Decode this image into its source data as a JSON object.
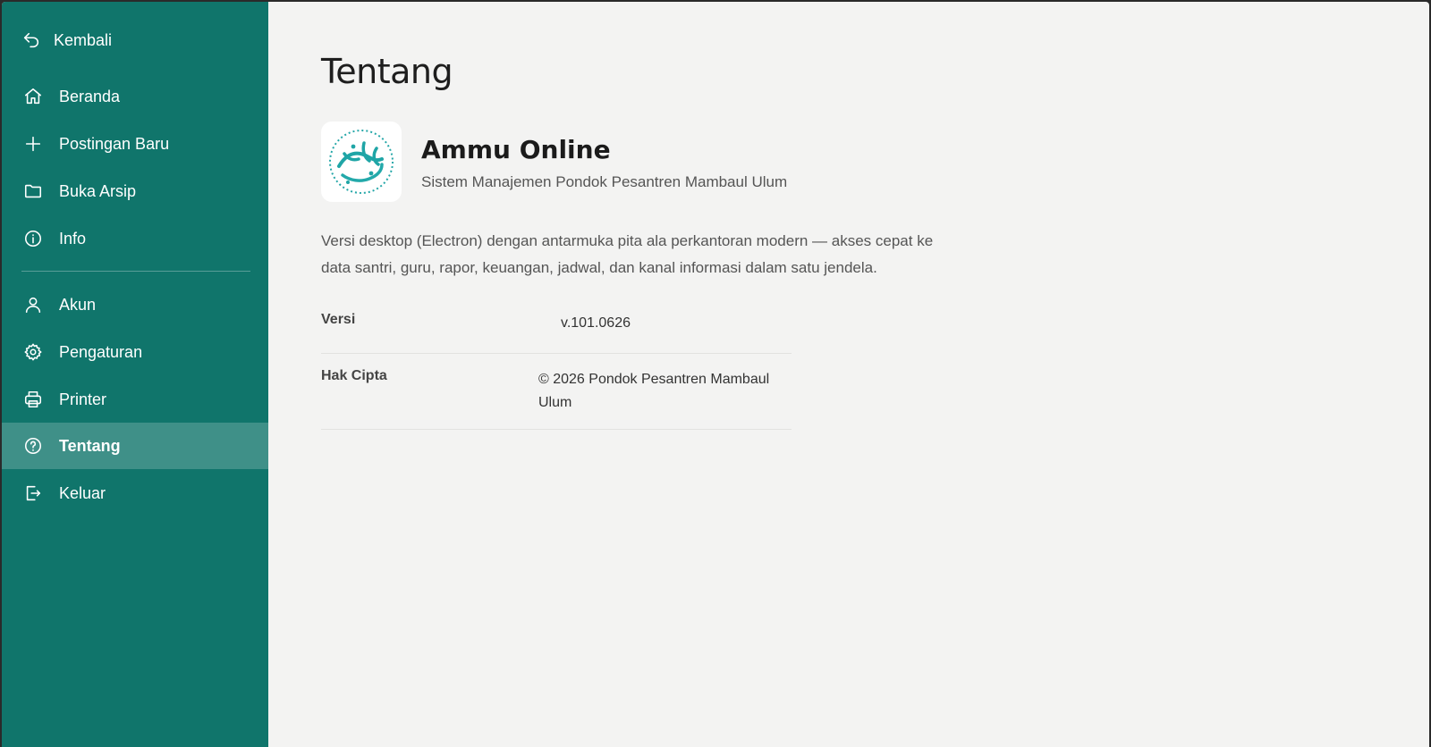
{
  "sidebar": {
    "back_label": "Kembali",
    "items": [
      {
        "label": "Beranda",
        "icon": "home-icon"
      },
      {
        "label": "Postingan Baru",
        "icon": "plus-icon"
      },
      {
        "label": "Buka Arsip",
        "icon": "folder-icon"
      },
      {
        "label": "Info",
        "icon": "info-icon"
      },
      {
        "label": "Akun",
        "icon": "user-icon"
      },
      {
        "label": "Pengaturan",
        "icon": "gear-icon"
      },
      {
        "label": "Printer",
        "icon": "printer-icon"
      },
      {
        "label": "Tentang",
        "icon": "help-circle-icon",
        "active": true
      },
      {
        "label": "Keluar",
        "icon": "logout-icon"
      }
    ],
    "colors": {
      "background": "#10756b",
      "active": "#3f9088"
    }
  },
  "main": {
    "title": "Tentang",
    "app": {
      "name": "Ammu Online",
      "subtitle": "Sistem Manajemen Pondok Pesantren Mambaul Ulum",
      "logo_icon": "arabic-calligraphy-logo",
      "logo_text": "منبع العلوم"
    },
    "description": "Versi desktop (Electron) dengan antarmuka pita ala perkantoran modern — akses cepat ke data santri, guru, rapor, keuangan, jadwal, dan kanal informasi dalam satu jendela.",
    "info": [
      {
        "key": "Versi",
        "value": "v.101.0626"
      },
      {
        "key": "Hak Cipta",
        "value": "© 2026 Pondok Pesantren Mambaul Ulum"
      }
    ]
  }
}
